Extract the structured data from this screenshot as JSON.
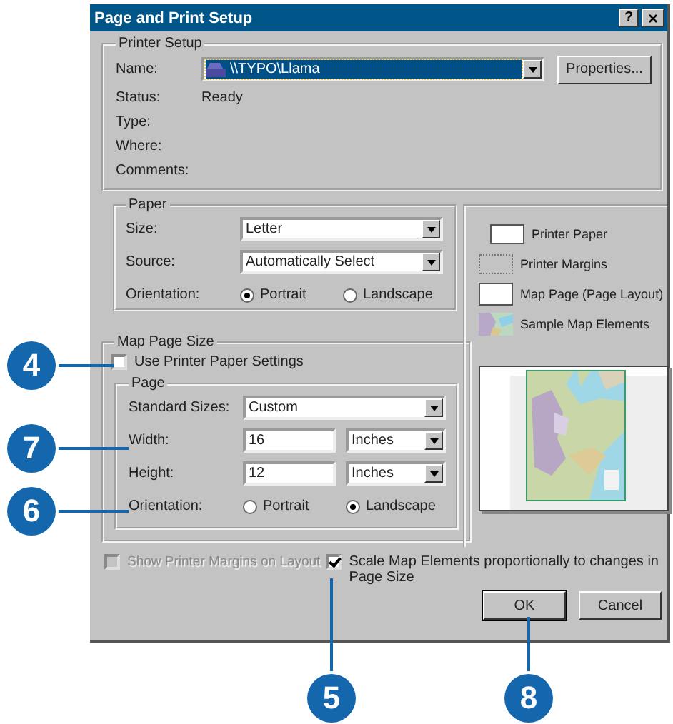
{
  "window": {
    "title": "Page and Print Setup",
    "title_buttons": [
      {
        "kind": "help",
        "label": "?"
      },
      {
        "kind": "close",
        "label": "×"
      }
    ]
  },
  "printer_setup": {
    "legend": "Printer Setup",
    "name_label": "Name:",
    "name_value": "\\\\TYPO\\Llama",
    "properties_button": "Properties...",
    "info": [
      {
        "label": "Status:",
        "value": "Ready"
      },
      {
        "label": "Type:"
      },
      {
        "label": "Where:"
      },
      {
        "label": "Comments:"
      }
    ]
  },
  "paper": {
    "legend": "Paper",
    "size_label": "Size:",
    "size_value": "Letter",
    "source_label": "Source:",
    "source_value": "Automatically Select",
    "orientation_label": "Orientation:",
    "orientation": [
      {
        "label": "Portrait",
        "selected": true
      },
      {
        "label": "Landscape",
        "selected": false
      }
    ]
  },
  "map_page_size": {
    "legend": "Map Page Size",
    "use_printer_paper": {
      "label": "Use Printer Paper Settings",
      "checked": false
    },
    "page": {
      "legend": "Page",
      "standard_label": "Standard Sizes:",
      "standard_value": "Custom",
      "width_label": "Width:",
      "width_value": "16",
      "width_unit": "Inches",
      "height_label": "Height:",
      "height_value": "12",
      "height_unit": "Inches",
      "orientation_label": "Orientation:",
      "orientation": [
        {
          "label": "Portrait",
          "selected": false
        },
        {
          "label": "Landscape",
          "selected": true
        }
      ]
    }
  },
  "legend_items": [
    {
      "kind": "paper",
      "label": "Printer Paper"
    },
    {
      "kind": "margins",
      "label": "Printer Margins"
    },
    {
      "kind": "page",
      "label": "Map Page (Page Layout)"
    },
    {
      "kind": "elements",
      "label": "Sample Map Elements"
    }
  ],
  "options": [
    {
      "label": "Show Printer Margins on Layout",
      "checked": false,
      "disabled": true
    },
    {
      "label": "Scale Map Elements proportionally to changes in Page Size",
      "checked": true,
      "disabled": false
    }
  ],
  "buttons": [
    {
      "label": "OK",
      "default": true
    },
    {
      "label": "Cancel",
      "default": false
    }
  ],
  "callouts": [
    "4",
    "7",
    "6",
    "5",
    "8"
  ]
}
